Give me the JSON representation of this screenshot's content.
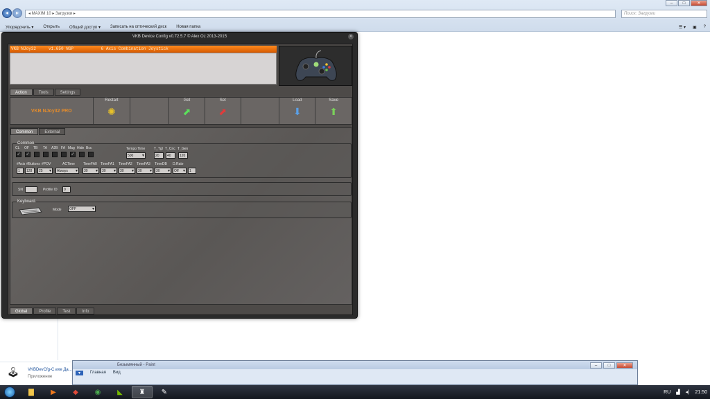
{
  "explorer": {
    "address": "◂ MAXIM 10 ▸ Загрузки ▸",
    "search_placeholder": "Поиск: Загрузки",
    "commands": [
      "Упорядочить ▾",
      "Открыть",
      "Общий доступ ▾",
      "Записать на оптический диск",
      "Новая папка"
    ],
    "caption": {
      "min": "–",
      "max": "□",
      "close": "✕"
    }
  },
  "vkb": {
    "title": "VKB Device Config v0.72.5.7 © Alex Oz 2013-2015",
    "device_line": "VKB NJoy32     v1.650 NGP           6 Axis Combination Joystick",
    "main_tabs": [
      "Action",
      "Tools",
      "Settings"
    ],
    "profile_name": "VKB NJoy32 PRO",
    "toolbar": {
      "restart": "Restart",
      "get": "Get",
      "set": "Set",
      "load": "Load",
      "save": "Save"
    },
    "sub_tabs": [
      "Common",
      "External"
    ],
    "common": {
      "group": "Common",
      "checkbox_labels": [
        "CL",
        "OF",
        "TB",
        "TA",
        "A2B",
        "FA",
        "Mag",
        "Hide",
        "Bcc"
      ],
      "checkbox_states": [
        true,
        true,
        false,
        false,
        false,
        false,
        true,
        false,
        false
      ],
      "tempo_label": "Tempo Time",
      "tempo_value": "500",
      "t_labels": [
        "T_Tgl",
        "T_Cnc",
        "T_Gen"
      ],
      "t_values": [
        "20",
        "40",
        "120"
      ],
      "row2_labels": [
        "#Axis",
        "#Buttons",
        "#POV",
        "ACTime",
        "TimeFA0",
        "TimeFA1",
        "TimeFA2",
        "TimeFA3",
        "TimeDB",
        "D.Rate"
      ],
      "row2_values": [
        "1",
        "128",
        "25",
        "Always",
        "30",
        "30",
        "30",
        "30",
        "30",
        "Off",
        "1"
      ]
    },
    "sn": {
      "label": "SN",
      "value": "",
      "profile_label": "Profile ID",
      "profile_value": "0"
    },
    "keyboard": {
      "group": "Keyboard",
      "mode_label": "Mode",
      "mode_value": "OFF"
    },
    "bottom_tabs": [
      "Global",
      "Profile",
      "Test",
      "Info"
    ]
  },
  "detail": {
    "file": "VKBDevCfg-C.exe Да...",
    "type": "Приложение"
  },
  "paint": {
    "title": "Безымянный - Paint",
    "menu_btn": "▾",
    "ribbon_tabs": [
      "Главная",
      "Вид"
    ]
  },
  "tray": {
    "lang": "RU",
    "time": "21:50"
  },
  "icons": [
    "search-icon",
    "folder-icon",
    "media-icon",
    "chrome-icon",
    "nvidia-icon",
    "joystick-icon",
    "network-icon",
    "volume-icon"
  ]
}
